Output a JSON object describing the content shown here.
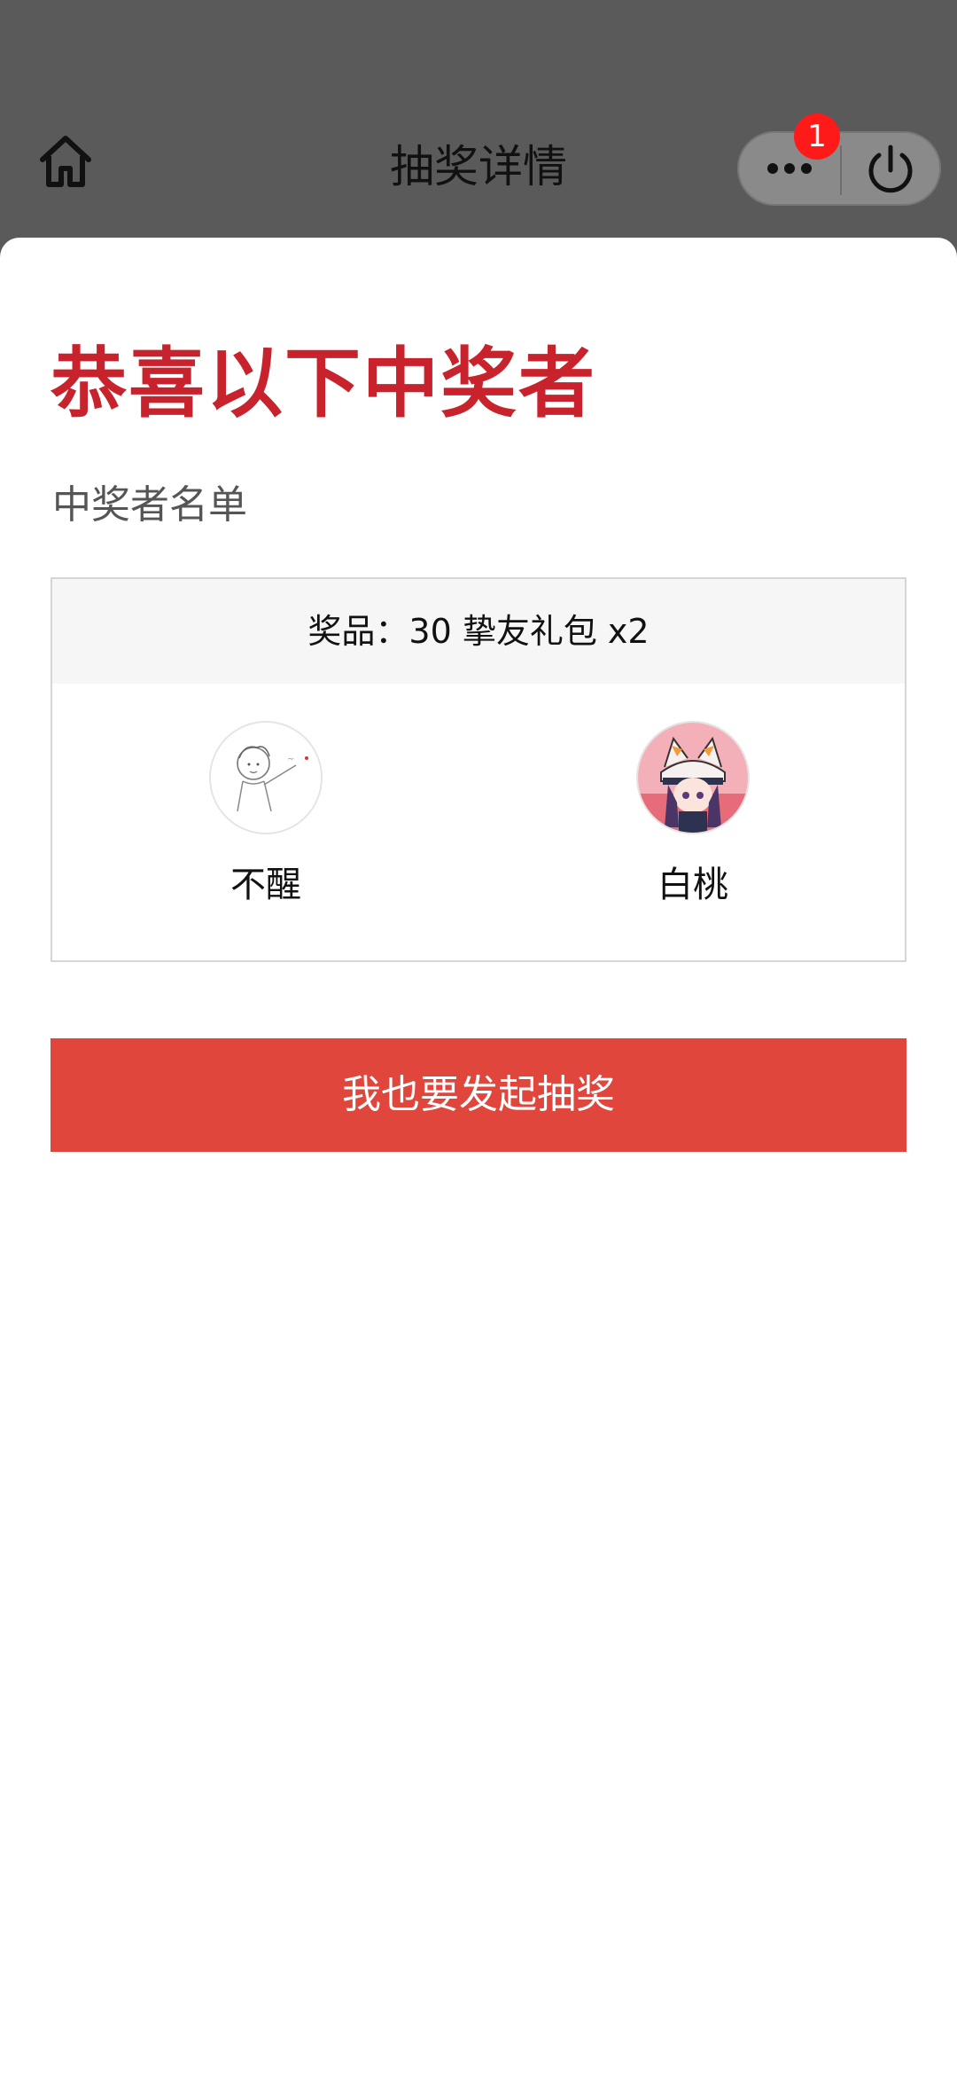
{
  "nav": {
    "title": "抽奖详情",
    "badge_count": "1"
  },
  "content": {
    "headline": "恭喜以下中奖者",
    "list_label": "中奖者名单",
    "prize": "奖品：30 挚友礼包 x2",
    "winners": [
      {
        "name": "不醒",
        "avatar": "sketch-boy-avatar"
      },
      {
        "name": "白桃",
        "avatar": "anime-cat-hat-avatar"
      }
    ],
    "cta_label": "我也要发起抽奖"
  },
  "colors": {
    "headline": "#c8232c",
    "cta_background": "#e0463c",
    "badge": "#ff1a1a",
    "nav_background": "#5a5a5a"
  }
}
